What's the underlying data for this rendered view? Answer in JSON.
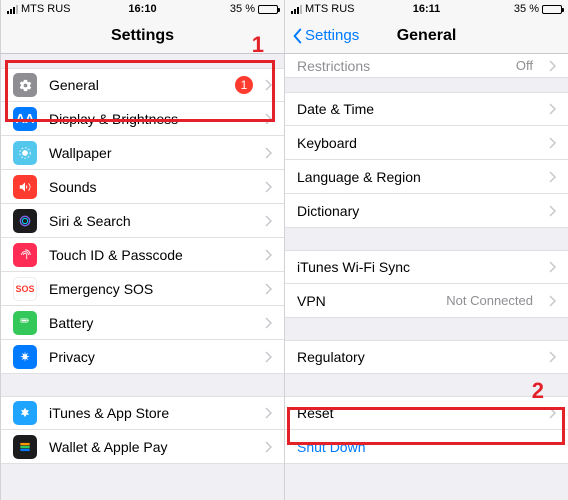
{
  "left": {
    "status": {
      "carrier": "MTS RUS",
      "time": "16:10",
      "battery_text": "35 %"
    },
    "title": "Settings",
    "annotation_num": "1",
    "rows": [
      {
        "label": "General",
        "badge": "1"
      },
      {
        "label": "Display & Brightness"
      },
      {
        "label": "Wallpaper"
      },
      {
        "label": "Sounds"
      },
      {
        "label": "Siri & Search"
      },
      {
        "label": "Touch ID & Passcode"
      },
      {
        "label": "Emergency SOS"
      },
      {
        "label": "Battery"
      },
      {
        "label": "Privacy"
      }
    ],
    "rows2": [
      {
        "label": "iTunes & App Store"
      },
      {
        "label": "Wallet & Apple Pay"
      }
    ]
  },
  "right": {
    "status": {
      "carrier": "MTS RUS",
      "time": "16:11",
      "battery_text": "35 %"
    },
    "back": "Settings",
    "title": "General",
    "annotation_num": "2",
    "restrictions": {
      "label": "Restrictions",
      "value": "Off"
    },
    "sec1": [
      {
        "label": "Date & Time"
      },
      {
        "label": "Keyboard"
      },
      {
        "label": "Language & Region"
      },
      {
        "label": "Dictionary"
      }
    ],
    "sec2": [
      {
        "label": "iTunes Wi-Fi Sync"
      },
      {
        "label": "VPN",
        "value": "Not Connected"
      }
    ],
    "sec3": [
      {
        "label": "Regulatory"
      }
    ],
    "sec4": [
      {
        "label": "Reset"
      },
      {
        "label": "Shut Down",
        "link": true
      }
    ]
  }
}
